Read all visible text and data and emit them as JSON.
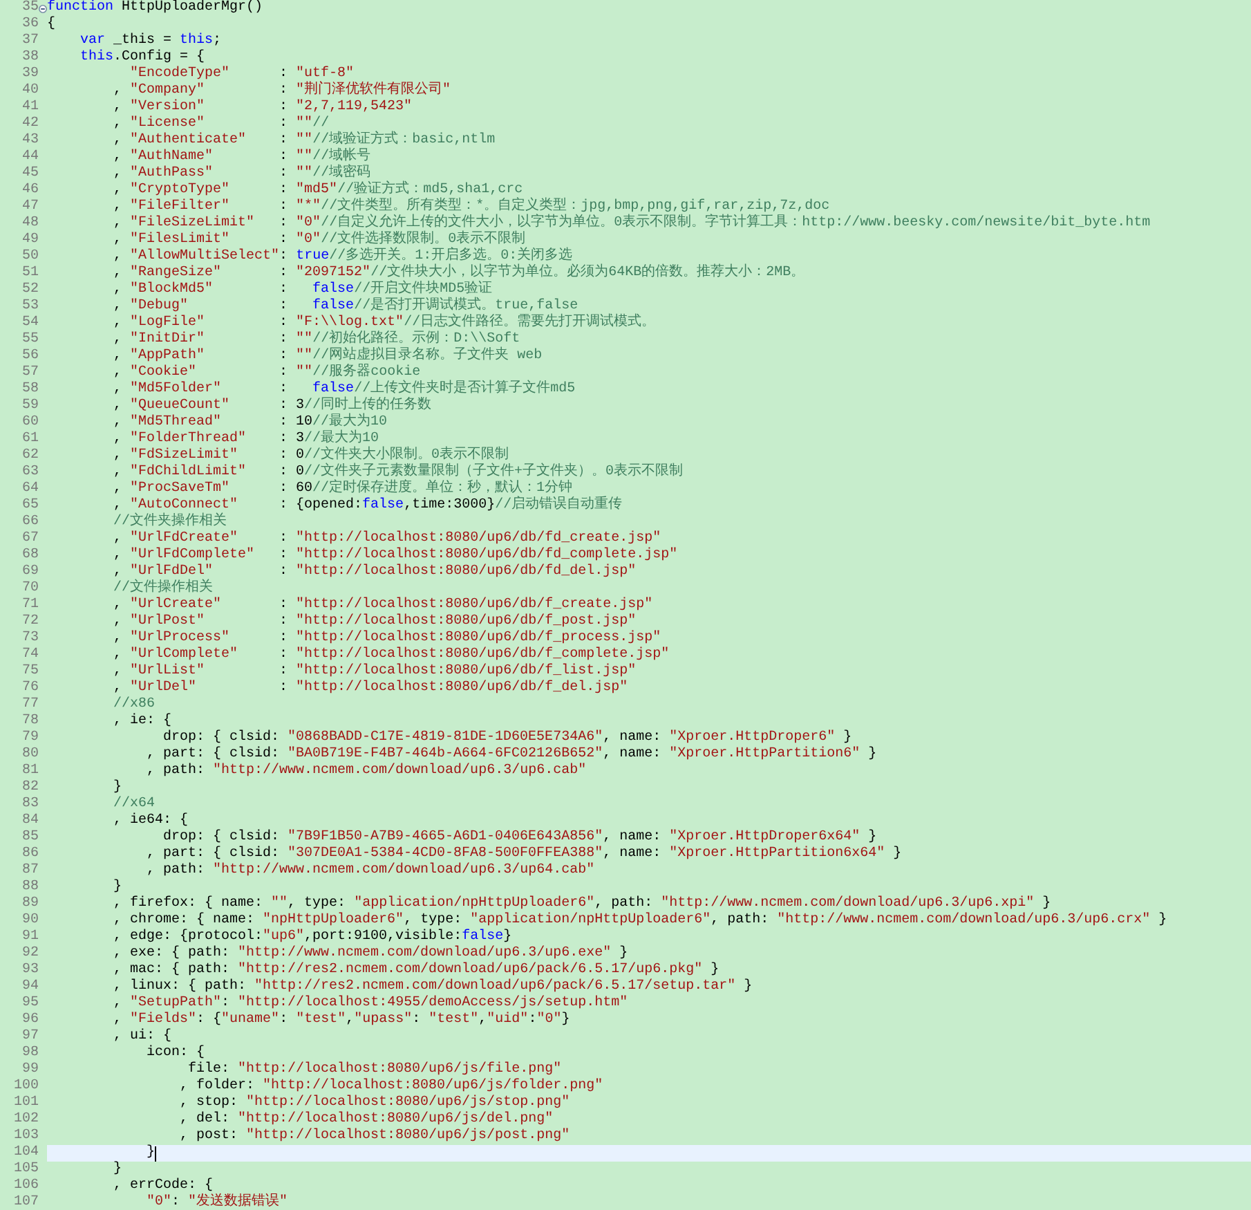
{
  "editor": {
    "lines": [
      {
        "number": "35",
        "fold": true,
        "current": false,
        "tokens": [
          {
            "kind": "kw",
            "text": "function"
          },
          {
            "kind": "plain",
            "text": " HttpUploaderMgr()"
          }
        ]
      },
      {
        "number": "36",
        "fold": false,
        "current": false,
        "tokens": [
          {
            "kind": "plain",
            "text": "{"
          }
        ]
      },
      {
        "number": "37",
        "fold": false,
        "current": false,
        "tokens": [
          {
            "kind": "kw",
            "text": "    var"
          },
          {
            "kind": "plain",
            "text": " _this = "
          },
          {
            "kind": "kw",
            "text": "this"
          },
          {
            "kind": "plain",
            "text": ";"
          }
        ]
      },
      {
        "number": "38",
        "fold": false,
        "current": false,
        "tokens": [
          {
            "kind": "kw",
            "text": "    this"
          },
          {
            "kind": "plain",
            "text": ".Config = {"
          }
        ]
      },
      {
        "number": "39",
        "fold": false,
        "current": false,
        "tokens": [
          {
            "kind": "str",
            "text": "          \"EncodeType\""
          },
          {
            "kind": "plain",
            "text": "      : "
          },
          {
            "kind": "str",
            "text": "\"utf-8\""
          }
        ]
      },
      {
        "number": "40",
        "fold": false,
        "current": false,
        "tokens": [
          {
            "kind": "plain",
            "text": "        , "
          },
          {
            "kind": "str",
            "text": "\"Company\""
          },
          {
            "kind": "plain",
            "text": "         : "
          },
          {
            "kind": "str",
            "text": "\"荆门泽优软件有限公司\""
          }
        ]
      },
      {
        "number": "41",
        "fold": false,
        "current": false,
        "tokens": [
          {
            "kind": "plain",
            "text": "        , "
          },
          {
            "kind": "str",
            "text": "\"Version\""
          },
          {
            "kind": "plain",
            "text": "         : "
          },
          {
            "kind": "str",
            "text": "\"2,7,119,5423\""
          }
        ]
      },
      {
        "number": "42",
        "fold": false,
        "current": false,
        "tokens": [
          {
            "kind": "plain",
            "text": "        , "
          },
          {
            "kind": "str",
            "text": "\"License\""
          },
          {
            "kind": "plain",
            "text": "         : "
          },
          {
            "kind": "str",
            "text": "\"\""
          },
          {
            "kind": "cmt",
            "text": "//"
          }
        ]
      },
      {
        "number": "43",
        "fold": false,
        "current": false,
        "tokens": [
          {
            "kind": "plain",
            "text": "        , "
          },
          {
            "kind": "str",
            "text": "\"Authenticate\""
          },
          {
            "kind": "plain",
            "text": "    : "
          },
          {
            "kind": "str",
            "text": "\"\""
          },
          {
            "kind": "cmt",
            "text": "//域验证方式：basic,ntlm"
          }
        ]
      },
      {
        "number": "44",
        "fold": false,
        "current": false,
        "tokens": [
          {
            "kind": "plain",
            "text": "        , "
          },
          {
            "kind": "str",
            "text": "\"AuthName\""
          },
          {
            "kind": "plain",
            "text": "        : "
          },
          {
            "kind": "str",
            "text": "\"\""
          },
          {
            "kind": "cmt",
            "text": "//域帐号"
          }
        ]
      },
      {
        "number": "45",
        "fold": false,
        "current": false,
        "tokens": [
          {
            "kind": "plain",
            "text": "        , "
          },
          {
            "kind": "str",
            "text": "\"AuthPass\""
          },
          {
            "kind": "plain",
            "text": "        : "
          },
          {
            "kind": "str",
            "text": "\"\""
          },
          {
            "kind": "cmt",
            "text": "//域密码"
          }
        ]
      },
      {
        "number": "46",
        "fold": false,
        "current": false,
        "tokens": [
          {
            "kind": "plain",
            "text": "        , "
          },
          {
            "kind": "str",
            "text": "\"CryptoType\""
          },
          {
            "kind": "plain",
            "text": "      : "
          },
          {
            "kind": "str",
            "text": "\"md5\""
          },
          {
            "kind": "cmt",
            "text": "//验证方式：md5,sha1,crc"
          }
        ]
      },
      {
        "number": "47",
        "fold": false,
        "current": false,
        "tokens": [
          {
            "kind": "plain",
            "text": "        , "
          },
          {
            "kind": "str",
            "text": "\"FileFilter\""
          },
          {
            "kind": "plain",
            "text": "      : "
          },
          {
            "kind": "str",
            "text": "\"*\""
          },
          {
            "kind": "cmt",
            "text": "//文件类型。所有类型：*。自定义类型：jpg,bmp,png,gif,rar,zip,7z,doc"
          }
        ]
      },
      {
        "number": "48",
        "fold": false,
        "current": false,
        "tokens": [
          {
            "kind": "plain",
            "text": "        , "
          },
          {
            "kind": "str",
            "text": "\"FileSizeLimit\""
          },
          {
            "kind": "plain",
            "text": "   : "
          },
          {
            "kind": "str",
            "text": "\"0\""
          },
          {
            "kind": "cmt",
            "text": "//自定义允许上传的文件大小，以字节为单位。0表示不限制。字节计算工具：http://www.beesky.com/newsite/bit_byte.htm"
          }
        ]
      },
      {
        "number": "49",
        "fold": false,
        "current": false,
        "tokens": [
          {
            "kind": "plain",
            "text": "        , "
          },
          {
            "kind": "str",
            "text": "\"FilesLimit\""
          },
          {
            "kind": "plain",
            "text": "      : "
          },
          {
            "kind": "str",
            "text": "\"0\""
          },
          {
            "kind": "cmt",
            "text": "//文件选择数限制。0表示不限制"
          }
        ]
      },
      {
        "number": "50",
        "fold": false,
        "current": false,
        "tokens": [
          {
            "kind": "plain",
            "text": "        , "
          },
          {
            "kind": "str",
            "text": "\"AllowMultiSelect\""
          },
          {
            "kind": "plain",
            "text": ": "
          },
          {
            "kind": "kw",
            "text": "true"
          },
          {
            "kind": "cmt",
            "text": "//多选开关。1:开启多选。0:关闭多选"
          }
        ]
      },
      {
        "number": "51",
        "fold": false,
        "current": false,
        "tokens": [
          {
            "kind": "plain",
            "text": "        , "
          },
          {
            "kind": "str",
            "text": "\"RangeSize\""
          },
          {
            "kind": "plain",
            "text": "       : "
          },
          {
            "kind": "str",
            "text": "\"2097152\""
          },
          {
            "kind": "cmt",
            "text": "//文件块大小，以字节为单位。必须为64KB的倍数。推荐大小：2MB。"
          }
        ]
      },
      {
        "number": "52",
        "fold": false,
        "current": false,
        "tokens": [
          {
            "kind": "plain",
            "text": "        , "
          },
          {
            "kind": "str",
            "text": "\"BlockMd5\""
          },
          {
            "kind": "plain",
            "text": "        :   "
          },
          {
            "kind": "kw",
            "text": "false"
          },
          {
            "kind": "cmt",
            "text": "//开启文件块MD5验证"
          }
        ]
      },
      {
        "number": "53",
        "fold": false,
        "current": false,
        "tokens": [
          {
            "kind": "plain",
            "text": "        , "
          },
          {
            "kind": "str",
            "text": "\"Debug\""
          },
          {
            "kind": "plain",
            "text": "           :   "
          },
          {
            "kind": "kw",
            "text": "false"
          },
          {
            "kind": "cmt",
            "text": "//是否打开调试模式。true,false"
          }
        ]
      },
      {
        "number": "54",
        "fold": false,
        "current": false,
        "tokens": [
          {
            "kind": "plain",
            "text": "        , "
          },
          {
            "kind": "str",
            "text": "\"LogFile\""
          },
          {
            "kind": "plain",
            "text": "         : "
          },
          {
            "kind": "str",
            "text": "\"F:\\\\log.txt\""
          },
          {
            "kind": "cmt",
            "text": "//日志文件路径。需要先打开调试模式。"
          }
        ]
      },
      {
        "number": "55",
        "fold": false,
        "current": false,
        "tokens": [
          {
            "kind": "plain",
            "text": "        , "
          },
          {
            "kind": "str",
            "text": "\"InitDir\""
          },
          {
            "kind": "plain",
            "text": "         : "
          },
          {
            "kind": "str",
            "text": "\"\""
          },
          {
            "kind": "cmt",
            "text": "//初始化路径。示例：D:\\\\Soft"
          }
        ]
      },
      {
        "number": "56",
        "fold": false,
        "current": false,
        "tokens": [
          {
            "kind": "plain",
            "text": "        , "
          },
          {
            "kind": "str",
            "text": "\"AppPath\""
          },
          {
            "kind": "plain",
            "text": "         : "
          },
          {
            "kind": "str",
            "text": "\"\""
          },
          {
            "kind": "cmt",
            "text": "//网站虚拟目录名称。子文件夹 web"
          }
        ]
      },
      {
        "number": "57",
        "fold": false,
        "current": false,
        "tokens": [
          {
            "kind": "plain",
            "text": "        , "
          },
          {
            "kind": "str",
            "text": "\"Cookie\""
          },
          {
            "kind": "plain",
            "text": "          : "
          },
          {
            "kind": "str",
            "text": "\"\""
          },
          {
            "kind": "cmt",
            "text": "//服务器cookie"
          }
        ]
      },
      {
        "number": "58",
        "fold": false,
        "current": false,
        "tokens": [
          {
            "kind": "plain",
            "text": "        , "
          },
          {
            "kind": "str",
            "text": "\"Md5Folder\""
          },
          {
            "kind": "plain",
            "text": "       :   "
          },
          {
            "kind": "kw",
            "text": "false"
          },
          {
            "kind": "cmt",
            "text": "//上传文件夹时是否计算子文件md5"
          }
        ]
      },
      {
        "number": "59",
        "fold": false,
        "current": false,
        "tokens": [
          {
            "kind": "plain",
            "text": "        , "
          },
          {
            "kind": "str",
            "text": "\"QueueCount\""
          },
          {
            "kind": "plain",
            "text": "      : 3"
          },
          {
            "kind": "cmt",
            "text": "//同时上传的任务数"
          }
        ]
      },
      {
        "number": "60",
        "fold": false,
        "current": false,
        "tokens": [
          {
            "kind": "plain",
            "text": "        , "
          },
          {
            "kind": "str",
            "text": "\"Md5Thread\""
          },
          {
            "kind": "plain",
            "text": "       : 10"
          },
          {
            "kind": "cmt",
            "text": "//最大为10"
          }
        ]
      },
      {
        "number": "61",
        "fold": false,
        "current": false,
        "tokens": [
          {
            "kind": "plain",
            "text": "        , "
          },
          {
            "kind": "str",
            "text": "\"FolderThread\""
          },
          {
            "kind": "plain",
            "text": "    : 3"
          },
          {
            "kind": "cmt",
            "text": "//最大为10"
          }
        ]
      },
      {
        "number": "62",
        "fold": false,
        "current": false,
        "tokens": [
          {
            "kind": "plain",
            "text": "        , "
          },
          {
            "kind": "str",
            "text": "\"FdSizeLimit\""
          },
          {
            "kind": "plain",
            "text": "     : 0"
          },
          {
            "kind": "cmt",
            "text": "//文件夹大小限制。0表示不限制"
          }
        ]
      },
      {
        "number": "63",
        "fold": false,
        "current": false,
        "tokens": [
          {
            "kind": "plain",
            "text": "        , "
          },
          {
            "kind": "str",
            "text": "\"FdChildLimit\""
          },
          {
            "kind": "plain",
            "text": "    : 0"
          },
          {
            "kind": "cmt",
            "text": "//文件夹子元素数量限制（子文件+子文件夹）。0表示不限制"
          }
        ]
      },
      {
        "number": "64",
        "fold": false,
        "current": false,
        "tokens": [
          {
            "kind": "plain",
            "text": "        , "
          },
          {
            "kind": "str",
            "text": "\"ProcSaveTm\""
          },
          {
            "kind": "plain",
            "text": "      : 60"
          },
          {
            "kind": "cmt",
            "text": "//定时保存进度。单位：秒，默认：1分钟"
          }
        ]
      },
      {
        "number": "65",
        "fold": false,
        "current": false,
        "tokens": [
          {
            "kind": "plain",
            "text": "        , "
          },
          {
            "kind": "str",
            "text": "\"AutoConnect\""
          },
          {
            "kind": "plain",
            "text": "     : {opened:"
          },
          {
            "kind": "kw",
            "text": "false"
          },
          {
            "kind": "plain",
            "text": ",time:3000}"
          },
          {
            "kind": "cmt",
            "text": "//启动错误自动重传"
          }
        ]
      },
      {
        "number": "66",
        "fold": false,
        "current": false,
        "tokens": [
          {
            "kind": "cmt",
            "text": "        //文件夹操作相关"
          }
        ]
      },
      {
        "number": "67",
        "fold": false,
        "current": false,
        "tokens": [
          {
            "kind": "plain",
            "text": "        , "
          },
          {
            "kind": "str",
            "text": "\"UrlFdCreate\""
          },
          {
            "kind": "plain",
            "text": "     : "
          },
          {
            "kind": "str",
            "text": "\"http://localhost:8080/up6/db/fd_create.jsp\""
          }
        ]
      },
      {
        "number": "68",
        "fold": false,
        "current": false,
        "tokens": [
          {
            "kind": "plain",
            "text": "        , "
          },
          {
            "kind": "str",
            "text": "\"UrlFdComplete\""
          },
          {
            "kind": "plain",
            "text": "   : "
          },
          {
            "kind": "str",
            "text": "\"http://localhost:8080/up6/db/fd_complete.jsp\""
          }
        ]
      },
      {
        "number": "69",
        "fold": false,
        "current": false,
        "tokens": [
          {
            "kind": "plain",
            "text": "        , "
          },
          {
            "kind": "str",
            "text": "\"UrlFdDel\""
          },
          {
            "kind": "plain",
            "text": "        : "
          },
          {
            "kind": "str",
            "text": "\"http://localhost:8080/up6/db/fd_del.jsp\""
          }
        ]
      },
      {
        "number": "70",
        "fold": false,
        "current": false,
        "tokens": [
          {
            "kind": "cmt",
            "text": "        //文件操作相关"
          }
        ]
      },
      {
        "number": "71",
        "fold": false,
        "current": false,
        "tokens": [
          {
            "kind": "plain",
            "text": "        , "
          },
          {
            "kind": "str",
            "text": "\"UrlCreate\""
          },
          {
            "kind": "plain",
            "text": "       : "
          },
          {
            "kind": "str",
            "text": "\"http://localhost:8080/up6/db/f_create.jsp\""
          }
        ]
      },
      {
        "number": "72",
        "fold": false,
        "current": false,
        "tokens": [
          {
            "kind": "plain",
            "text": "        , "
          },
          {
            "kind": "str",
            "text": "\"UrlPost\""
          },
          {
            "kind": "plain",
            "text": "         : "
          },
          {
            "kind": "str",
            "text": "\"http://localhost:8080/up6/db/f_post.jsp\""
          }
        ]
      },
      {
        "number": "73",
        "fold": false,
        "current": false,
        "tokens": [
          {
            "kind": "plain",
            "text": "        , "
          },
          {
            "kind": "str",
            "text": "\"UrlProcess\""
          },
          {
            "kind": "plain",
            "text": "      : "
          },
          {
            "kind": "str",
            "text": "\"http://localhost:8080/up6/db/f_process.jsp\""
          }
        ]
      },
      {
        "number": "74",
        "fold": false,
        "current": false,
        "tokens": [
          {
            "kind": "plain",
            "text": "        , "
          },
          {
            "kind": "str",
            "text": "\"UrlComplete\""
          },
          {
            "kind": "plain",
            "text": "     : "
          },
          {
            "kind": "str",
            "text": "\"http://localhost:8080/up6/db/f_complete.jsp\""
          }
        ]
      },
      {
        "number": "75",
        "fold": false,
        "current": false,
        "tokens": [
          {
            "kind": "plain",
            "text": "        , "
          },
          {
            "kind": "str",
            "text": "\"UrlList\""
          },
          {
            "kind": "plain",
            "text": "         : "
          },
          {
            "kind": "str",
            "text": "\"http://localhost:8080/up6/db/f_list.jsp\""
          }
        ]
      },
      {
        "number": "76",
        "fold": false,
        "current": false,
        "tokens": [
          {
            "kind": "plain",
            "text": "        , "
          },
          {
            "kind": "str",
            "text": "\"UrlDel\""
          },
          {
            "kind": "plain",
            "text": "          : "
          },
          {
            "kind": "str",
            "text": "\"http://localhost:8080/up6/db/f_del.jsp\""
          }
        ]
      },
      {
        "number": "77",
        "fold": false,
        "current": false,
        "tokens": [
          {
            "kind": "cmt",
            "text": "        //x86"
          }
        ]
      },
      {
        "number": "78",
        "fold": false,
        "current": false,
        "tokens": [
          {
            "kind": "plain",
            "text": "        , ie: {"
          }
        ]
      },
      {
        "number": "79",
        "fold": false,
        "current": false,
        "tokens": [
          {
            "kind": "plain",
            "text": "              drop: { clsid: "
          },
          {
            "kind": "str",
            "text": "\"0868BADD-C17E-4819-81DE-1D60E5E734A6\""
          },
          {
            "kind": "plain",
            "text": ", name: "
          },
          {
            "kind": "str",
            "text": "\"Xproer.HttpDroper6\""
          },
          {
            "kind": "plain",
            "text": " }"
          }
        ]
      },
      {
        "number": "80",
        "fold": false,
        "current": false,
        "tokens": [
          {
            "kind": "plain",
            "text": "            , part: { clsid: "
          },
          {
            "kind": "str",
            "text": "\"BA0B719E-F4B7-464b-A664-6FC02126B652\""
          },
          {
            "kind": "plain",
            "text": ", name: "
          },
          {
            "kind": "str",
            "text": "\"Xproer.HttpPartition6\""
          },
          {
            "kind": "plain",
            "text": " }"
          }
        ]
      },
      {
        "number": "81",
        "fold": false,
        "current": false,
        "tokens": [
          {
            "kind": "plain",
            "text": "            , path: "
          },
          {
            "kind": "str",
            "text": "\"http://www.ncmem.com/download/up6.3/up6.cab\""
          }
        ]
      },
      {
        "number": "82",
        "fold": false,
        "current": false,
        "tokens": [
          {
            "kind": "plain",
            "text": "        }"
          }
        ]
      },
      {
        "number": "83",
        "fold": false,
        "current": false,
        "tokens": [
          {
            "kind": "cmt",
            "text": "        //x64"
          }
        ]
      },
      {
        "number": "84",
        "fold": false,
        "current": false,
        "tokens": [
          {
            "kind": "plain",
            "text": "        , ie64: {"
          }
        ]
      },
      {
        "number": "85",
        "fold": false,
        "current": false,
        "tokens": [
          {
            "kind": "plain",
            "text": "              drop: { clsid: "
          },
          {
            "kind": "str",
            "text": "\"7B9F1B50-A7B9-4665-A6D1-0406E643A856\""
          },
          {
            "kind": "plain",
            "text": ", name: "
          },
          {
            "kind": "str",
            "text": "\"Xproer.HttpDroper6x64\""
          },
          {
            "kind": "plain",
            "text": " }"
          }
        ]
      },
      {
        "number": "86",
        "fold": false,
        "current": false,
        "tokens": [
          {
            "kind": "plain",
            "text": "            , part: { clsid: "
          },
          {
            "kind": "str",
            "text": "\"307DE0A1-5384-4CD0-8FA8-500F0FFEA388\""
          },
          {
            "kind": "plain",
            "text": ", name: "
          },
          {
            "kind": "str",
            "text": "\"Xproer.HttpPartition6x64\""
          },
          {
            "kind": "plain",
            "text": " }"
          }
        ]
      },
      {
        "number": "87",
        "fold": false,
        "current": false,
        "tokens": [
          {
            "kind": "plain",
            "text": "            , path: "
          },
          {
            "kind": "str",
            "text": "\"http://www.ncmem.com/download/up6.3/up64.cab\""
          }
        ]
      },
      {
        "number": "88",
        "fold": false,
        "current": false,
        "tokens": [
          {
            "kind": "plain",
            "text": "        }"
          }
        ]
      },
      {
        "number": "89",
        "fold": false,
        "current": false,
        "tokens": [
          {
            "kind": "plain",
            "text": "        , firefox: { name: "
          },
          {
            "kind": "str",
            "text": "\"\""
          },
          {
            "kind": "plain",
            "text": ", type: "
          },
          {
            "kind": "str",
            "text": "\"application/npHttpUploader6\""
          },
          {
            "kind": "plain",
            "text": ", path: "
          },
          {
            "kind": "str",
            "text": "\"http://www.ncmem.com/download/up6.3/up6.xpi\""
          },
          {
            "kind": "plain",
            "text": " }"
          }
        ]
      },
      {
        "number": "90",
        "fold": false,
        "current": false,
        "tokens": [
          {
            "kind": "plain",
            "text": "        , chrome: { name: "
          },
          {
            "kind": "str",
            "text": "\"npHttpUploader6\""
          },
          {
            "kind": "plain",
            "text": ", type: "
          },
          {
            "kind": "str",
            "text": "\"application/npHttpUploader6\""
          },
          {
            "kind": "plain",
            "text": ", path: "
          },
          {
            "kind": "str",
            "text": "\"http://www.ncmem.com/download/up6.3/up6.crx\""
          },
          {
            "kind": "plain",
            "text": " }"
          }
        ]
      },
      {
        "number": "91",
        "fold": false,
        "current": false,
        "tokens": [
          {
            "kind": "plain",
            "text": "        , edge: {protocol:"
          },
          {
            "kind": "str",
            "text": "\"up6\""
          },
          {
            "kind": "plain",
            "text": ",port:9100,visible:"
          },
          {
            "kind": "kw",
            "text": "false"
          },
          {
            "kind": "plain",
            "text": "}"
          }
        ]
      },
      {
        "number": "92",
        "fold": false,
        "current": false,
        "tokens": [
          {
            "kind": "plain",
            "text": "        , exe: { path: "
          },
          {
            "kind": "str",
            "text": "\"http://www.ncmem.com/download/up6.3/up6.exe\""
          },
          {
            "kind": "plain",
            "text": " }"
          }
        ]
      },
      {
        "number": "93",
        "fold": false,
        "current": false,
        "tokens": [
          {
            "kind": "plain",
            "text": "        , mac: { path: "
          },
          {
            "kind": "str",
            "text": "\"http://res2.ncmem.com/download/up6/pack/6.5.17/up6.pkg\""
          },
          {
            "kind": "plain",
            "text": " }"
          }
        ]
      },
      {
        "number": "94",
        "fold": false,
        "current": false,
        "tokens": [
          {
            "kind": "plain",
            "text": "        , linux: { path: "
          },
          {
            "kind": "str",
            "text": "\"http://res2.ncmem.com/download/up6/pack/6.5.17/setup.tar\""
          },
          {
            "kind": "plain",
            "text": " }"
          }
        ]
      },
      {
        "number": "95",
        "fold": false,
        "current": false,
        "tokens": [
          {
            "kind": "plain",
            "text": "        , "
          },
          {
            "kind": "str",
            "text": "\"SetupPath\""
          },
          {
            "kind": "plain",
            "text": ": "
          },
          {
            "kind": "str",
            "text": "\"http://localhost:4955/demoAccess/js/setup.htm\""
          }
        ]
      },
      {
        "number": "96",
        "fold": false,
        "current": false,
        "tokens": [
          {
            "kind": "plain",
            "text": "        , "
          },
          {
            "kind": "str",
            "text": "\"Fields\""
          },
          {
            "kind": "plain",
            "text": ": {"
          },
          {
            "kind": "str",
            "text": "\"uname\""
          },
          {
            "kind": "plain",
            "text": ": "
          },
          {
            "kind": "str",
            "text": "\"test\""
          },
          {
            "kind": "plain",
            "text": ","
          },
          {
            "kind": "str",
            "text": "\"upass\""
          },
          {
            "kind": "plain",
            "text": ": "
          },
          {
            "kind": "str",
            "text": "\"test\""
          },
          {
            "kind": "plain",
            "text": ","
          },
          {
            "kind": "str",
            "text": "\"uid\""
          },
          {
            "kind": "plain",
            "text": ":"
          },
          {
            "kind": "str",
            "text": "\"0\""
          },
          {
            "kind": "plain",
            "text": "}"
          }
        ]
      },
      {
        "number": "97",
        "fold": false,
        "current": false,
        "tokens": [
          {
            "kind": "plain",
            "text": "        , ui: {"
          }
        ]
      },
      {
        "number": "98",
        "fold": false,
        "current": false,
        "tokens": [
          {
            "kind": "plain",
            "text": "            icon: {"
          }
        ]
      },
      {
        "number": "99",
        "fold": false,
        "current": false,
        "tokens": [
          {
            "kind": "plain",
            "text": "                 file: "
          },
          {
            "kind": "str",
            "text": "\"http://localhost:8080/up6/js/file.png\""
          }
        ]
      },
      {
        "number": "100",
        "fold": false,
        "current": false,
        "tokens": [
          {
            "kind": "plain",
            "text": "                , folder: "
          },
          {
            "kind": "str",
            "text": "\"http://localhost:8080/up6/js/folder.png\""
          }
        ]
      },
      {
        "number": "101",
        "fold": false,
        "current": false,
        "tokens": [
          {
            "kind": "plain",
            "text": "                , stop: "
          },
          {
            "kind": "str",
            "text": "\"http://localhost:8080/up6/js/stop.png\""
          }
        ]
      },
      {
        "number": "102",
        "fold": false,
        "current": false,
        "tokens": [
          {
            "kind": "plain",
            "text": "                , del: "
          },
          {
            "kind": "str",
            "text": "\"http://localhost:8080/up6/js/del.png\""
          }
        ]
      },
      {
        "number": "103",
        "fold": false,
        "current": false,
        "tokens": [
          {
            "kind": "plain",
            "text": "                , post: "
          },
          {
            "kind": "str",
            "text": "\"http://localhost:8080/up6/js/post.png\""
          }
        ]
      },
      {
        "number": "104",
        "fold": false,
        "current": true,
        "tokens": [
          {
            "kind": "plain",
            "text": "            }"
          }
        ]
      },
      {
        "number": "105",
        "fold": false,
        "current": false,
        "tokens": [
          {
            "kind": "plain",
            "text": "        }"
          }
        ]
      },
      {
        "number": "106",
        "fold": false,
        "current": false,
        "tokens": [
          {
            "kind": "plain",
            "text": "        , errCode: {"
          }
        ]
      },
      {
        "number": "107",
        "fold": false,
        "current": false,
        "tokens": [
          {
            "kind": "str",
            "text": "            \"0\""
          },
          {
            "kind": "plain",
            "text": ": "
          },
          {
            "kind": "str",
            "text": "\"发送数据错误\""
          }
        ]
      }
    ]
  }
}
